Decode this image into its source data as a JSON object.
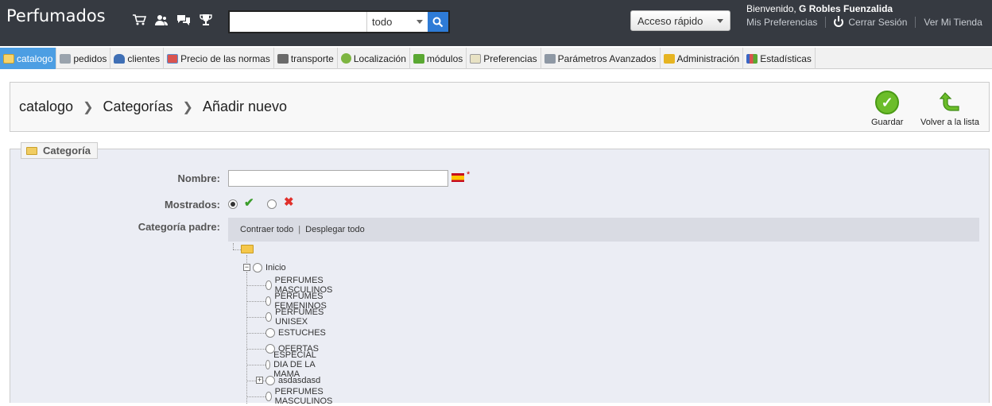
{
  "header": {
    "shop_name": "Perfumados",
    "icons": [
      "cart-icon",
      "customers-icon",
      "messages-icon",
      "trophy-icon"
    ],
    "search": {
      "placeholder": "",
      "scope": "todo"
    },
    "quick_access": "Acceso rápido",
    "welcome_prefix": "Bienvenido, ",
    "user_name": "G Robles Fuenzalida",
    "links": {
      "preferences": "Mis Preferencias",
      "logout": "Cerrar Sesión",
      "shop": "Ver Mi Tienda"
    }
  },
  "tabs": [
    {
      "label": "catalogo",
      "active": true
    },
    {
      "label": "pedidos"
    },
    {
      "label": "clientes"
    },
    {
      "label": "Precio de las normas"
    },
    {
      "label": "transporte"
    },
    {
      "label": "Localización"
    },
    {
      "label": "módulos"
    },
    {
      "label": "Preferencias"
    },
    {
      "label": "Parámetros Avanzados"
    },
    {
      "label": "Administración"
    },
    {
      "label": "Estadísticas"
    }
  ],
  "breadcrumb": {
    "level1": "catalogo",
    "level2": "Categorías",
    "level3": "Añadir nuevo"
  },
  "toolbar": {
    "save": "Guardar",
    "back": "Volver a la lista"
  },
  "form": {
    "legend": "Categoría",
    "name_label": "Nombre:",
    "name_value": "",
    "required_mark": "*",
    "displayed_label": "Mostrados:",
    "displayed": true,
    "parent_label": "Categoría padre:",
    "tree_collapse": "Contraer todo",
    "tree_separator": "|",
    "tree_expand": "Desplegar todo",
    "tree_root": "Inicio",
    "tree_children": [
      "PERFUMES MASCULINOS",
      "PERFUMES FEMENINOS",
      "PERFUMES UNISEX",
      "ESTUCHES",
      "OFERTAS",
      "ESPECIAL DIA DE LA MAMA",
      "asdasdasd",
      "PERFUMES MASCULINOS"
    ]
  }
}
